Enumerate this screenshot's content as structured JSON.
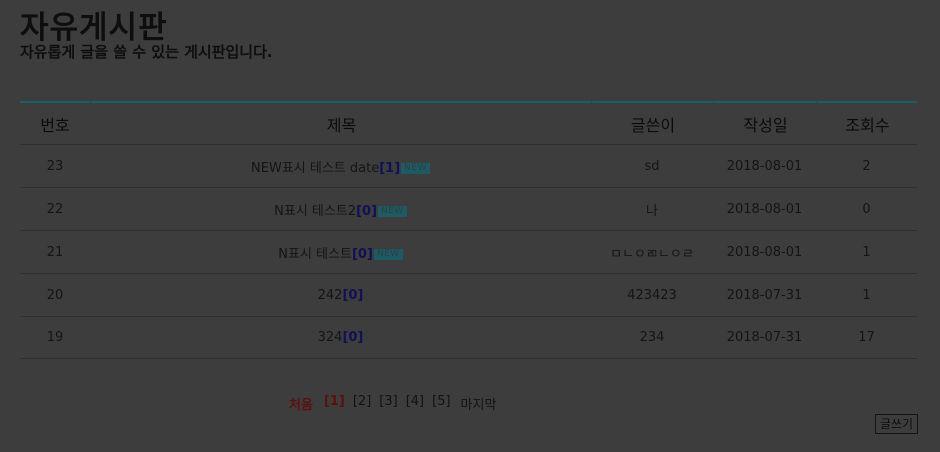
{
  "header": {
    "title": "자유게시판",
    "subtitle": "자유롭게 글을 쓸 수 있는 게시판입니다."
  },
  "table": {
    "columns": [
      "번호",
      "제목",
      "글쓴이",
      "작성일",
      "조회수"
    ],
    "rows": [
      {
        "num": "23",
        "title": "NEW표시 테스트 date",
        "comments": "[1]",
        "is_new": true,
        "new_label": "NEW",
        "writer": "sd",
        "date": "2018-08-01",
        "views": "2"
      },
      {
        "num": "22",
        "title": "N표시 테스트2",
        "comments": "[0]",
        "is_new": true,
        "new_label": "NEW",
        "writer": "나",
        "date": "2018-08-01",
        "views": "0"
      },
      {
        "num": "21",
        "title": "N표시 테스트",
        "comments": "[0]",
        "is_new": true,
        "new_label": "NEW",
        "writer": "ㅁㄴㅇㄻㄴㅇㄹ",
        "date": "2018-08-01",
        "views": "1"
      },
      {
        "num": "20",
        "title": "242",
        "comments": "[0]",
        "is_new": false,
        "writer": "423423",
        "date": "2018-07-31",
        "views": "1"
      },
      {
        "num": "19",
        "title": "324",
        "comments": "[0]",
        "is_new": false,
        "writer": "234",
        "date": "2018-07-31",
        "views": "17"
      }
    ]
  },
  "pagination": {
    "first": "처음",
    "pages": [
      "[1]",
      "[2]",
      "[3]",
      "[4]",
      "[5]"
    ],
    "current_index": 0,
    "last": "마지막"
  },
  "write_button": "글쓰기",
  "colors": {
    "background": "#3d3d3d",
    "header_rule": "#1a5f63",
    "comment_count": "#101058",
    "current_page": "#5a1010",
    "new_badge": "#1d5a64"
  }
}
